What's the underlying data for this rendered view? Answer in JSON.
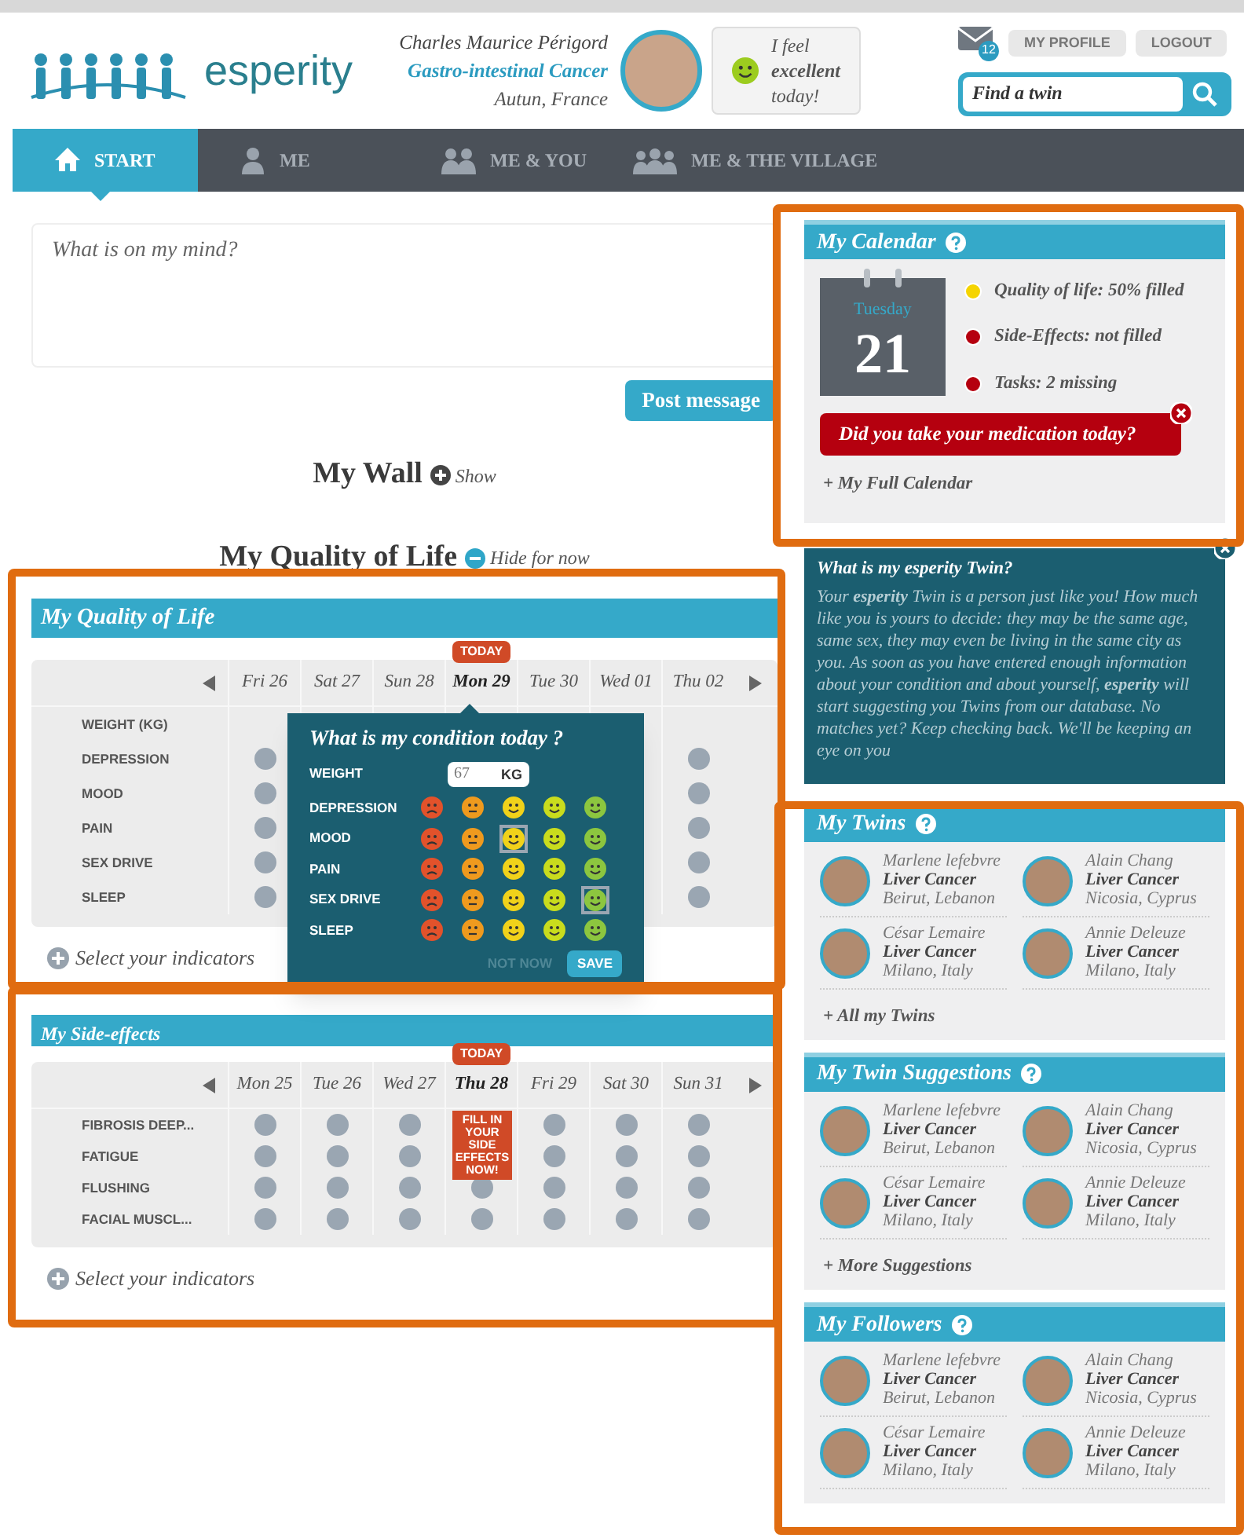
{
  "header": {
    "logo": "esperity",
    "user": {
      "name": "Charles Maurice Périgord",
      "condition": "Gastro-intestinal Cancer",
      "location": "Autun, France"
    },
    "mood": "I feel\n**excellent**\ntoday!",
    "mail_count": "12",
    "buttons": [
      "MY PROFILE",
      "LOGOUT"
    ],
    "search": {
      "placeholder": "Find a twin"
    }
  },
  "nav": [
    {
      "label": "START",
      "kind": "home",
      "selected": true
    },
    {
      "label": "ME",
      "kind": "person",
      "selected": false
    },
    {
      "label": "ME & YOU",
      "kind": "pair",
      "selected": false
    },
    {
      "label": "ME & THE VILLAGE",
      "kind": "group",
      "selected": false
    }
  ],
  "composer": {
    "placeholder": "What is on my mind?",
    "button": "Post message"
  },
  "sections": [
    {
      "title": "My Wall",
      "toggle": "Show",
      "expanded": false
    },
    {
      "title": "My Quality of Life",
      "toggle": "Hide for now",
      "expanded": true
    }
  ],
  "quality_of_life": {
    "title": "My Quality of Life",
    "today_badge": "TODAY",
    "days": [
      {
        "label": "Fri 26",
        "today": false
      },
      {
        "label": "Sat 27",
        "today": false
      },
      {
        "label": "Sun 28",
        "today": false
      },
      {
        "label": "Mon 29",
        "today": true
      },
      {
        "label": "Tue 30",
        "today": false
      },
      {
        "label": "Wed 01",
        "today": false
      },
      {
        "label": "Thu 02",
        "today": false
      }
    ],
    "rows": [
      {
        "label": "WEIGHT (KG)",
        "kind": "number"
      },
      {
        "label": "DEPRESSION",
        "kind": "scale"
      },
      {
        "label": "MOOD",
        "kind": "scale"
      },
      {
        "label": "PAIN",
        "kind": "scale"
      },
      {
        "label": "SEX DRIVE",
        "kind": "scale"
      },
      {
        "label": "SLEEP",
        "kind": "scale"
      }
    ],
    "footer": "Select your indicators",
    "popup": {
      "title": "What is my condition today ?",
      "weight": {
        "label": "WEIGHT",
        "value": "67",
        "unit": "KG"
      },
      "scale": [
        {
          "color": "#e2522b"
        },
        {
          "color": "#ef9a1e"
        },
        {
          "color": "#f1d21a"
        },
        {
          "color": "#c9dc1d"
        },
        {
          "color": "#8cc63f"
        }
      ],
      "rows": [
        {
          "label": "DEPRESSION",
          "choices": [
            {
              "selected": false
            },
            {
              "selected": false
            },
            {
              "selected": false
            },
            {
              "selected": false
            },
            {
              "selected": false
            }
          ]
        },
        {
          "label": "MOOD",
          "choices": [
            {
              "selected": false
            },
            {
              "selected": false
            },
            {
              "selected": true
            },
            {
              "selected": false
            },
            {
              "selected": false
            }
          ]
        },
        {
          "label": "PAIN",
          "choices": [
            {
              "selected": false
            },
            {
              "selected": false
            },
            {
              "selected": false
            },
            {
              "selected": false
            },
            {
              "selected": false
            }
          ]
        },
        {
          "label": "SEX DRIVE",
          "choices": [
            {
              "selected": false
            },
            {
              "selected": false
            },
            {
              "selected": false
            },
            {
              "selected": false
            },
            {
              "selected": true
            }
          ]
        },
        {
          "label": "SLEEP",
          "choices": [
            {
              "selected": false
            },
            {
              "selected": false
            },
            {
              "selected": false
            },
            {
              "selected": false
            },
            {
              "selected": false
            }
          ]
        }
      ],
      "cancel": "NOT NOW",
      "save": "SAVE"
    }
  },
  "side_effects": {
    "title": "My Side-effects",
    "today_badge": "TODAY",
    "callout": "FILL IN YOUR SIDE EFFECTS NOW!",
    "days": [
      {
        "label": "Mon 25",
        "today": false
      },
      {
        "label": "Tue 26",
        "today": false
      },
      {
        "label": "Wed 27",
        "today": false
      },
      {
        "label": "Thu 28",
        "today": true
      },
      {
        "label": "Fri 29",
        "today": false
      },
      {
        "label": "Sat 30",
        "today": false
      },
      {
        "label": "Sun 31",
        "today": false
      }
    ],
    "rows": [
      "FIBROSIS DEEP...",
      "FATIGUE",
      "FLUSHING",
      "FACIAL MUSCL..."
    ],
    "footer": "Select your indicators"
  },
  "calendar": {
    "title": "My Calendar",
    "weekday": "Tuesday",
    "day": "21",
    "items": [
      {
        "text": "Quality of life: 50% filled",
        "color": "#f5d400"
      },
      {
        "text": "Side-Effects: not filled",
        "color": "#b5000f"
      },
      {
        "text": "Tasks: 2 missing",
        "color": "#b5000f"
      }
    ],
    "alert": "Did you take your medication today?",
    "link": "+ My Full Calendar"
  },
  "info": {
    "title": "What is my esperity Twin?",
    "body": "Your **esperity** Twin is a person just like you! How much like you is yours to decide: they may be the same age, same sex, they may even be living in the same city as you. As soon as you have entered enough information about your condition and about yourself, **esperity** will start suggesting you Twins from our database. No matches yet? Keep checking back. We'll be keeping an eye on you"
  },
  "panels": [
    {
      "title": "My Twins",
      "people": [
        {
          "name": "Marlene lefebvre",
          "condition": "Liver Cancer",
          "location": "Beirut, Lebanon"
        },
        {
          "name": "Alain Chang",
          "condition": "Liver Cancer",
          "location": "Nicosia, Cyprus"
        },
        {
          "name": "César Lemaire",
          "condition": "Liver Cancer",
          "location": "Milano, Italy"
        },
        {
          "name": "Annie Deleuze",
          "condition": "Liver Cancer",
          "location": "Milano, Italy"
        }
      ],
      "link": "+ All my Twins"
    },
    {
      "title": "My Twin Suggestions",
      "people": [
        {
          "name": "Marlene lefebvre",
          "condition": "Liver Cancer",
          "location": "Beirut, Lebanon"
        },
        {
          "name": "Alain Chang",
          "condition": "Liver Cancer",
          "location": "Nicosia, Cyprus"
        },
        {
          "name": "César Lemaire",
          "condition": "Liver Cancer",
          "location": "Milano, Italy"
        },
        {
          "name": "Annie Deleuze",
          "condition": "Liver Cancer",
          "location": "Milano, Italy"
        }
      ],
      "link": "+ More Suggestions"
    },
    {
      "title": "My Followers",
      "people": [
        {
          "name": "Marlene lefebvre",
          "condition": "Liver Cancer",
          "location": "Beirut, Lebanon"
        },
        {
          "name": "Alain Chang",
          "condition": "Liver Cancer",
          "location": "Nicosia, Cyprus"
        },
        {
          "name": "César Lemaire",
          "condition": "Liver Cancer",
          "location": "Milano, Italy"
        },
        {
          "name": "Annie Deleuze",
          "condition": "Liver Cancer",
          "location": "Milano, Italy"
        }
      ]
    }
  ]
}
